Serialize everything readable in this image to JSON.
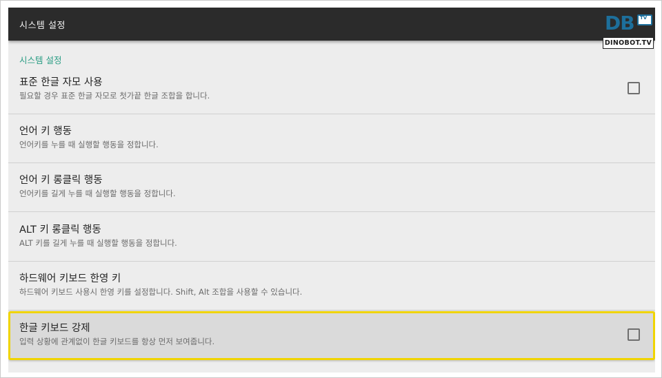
{
  "actionbar": {
    "title": "시스템 설정"
  },
  "category": {
    "label": "시스템 설정"
  },
  "preferences": [
    {
      "title": "표준 한글 자모 사용",
      "summary": "필요할 경우 표준 한글 자모로 첫가끝 한글 조합을 합니다.",
      "checked": false
    },
    {
      "title": "언어 키 행동",
      "summary": "언어키를 누를 때 실행할 행동을 정합니다."
    },
    {
      "title": "언어 키 롱클릭 행동",
      "summary": "언어키를 길게 누를 때 실행할 행동을 정합니다."
    },
    {
      "title": "ALT 키 롱클릭 행동",
      "summary": "ALT 키를 길게 누를 때 실행할 행동을 정합니다."
    },
    {
      "title": "하드웨어 키보드 한영 키",
      "summary": "하드웨어 키보드 사용시 한영 키를 설정합니다. Shift, Alt 조합을 사용할 수 있습니다."
    },
    {
      "title": "한글 키보드 강제",
      "summary": "입력 상황에 관계없이 한글 키보드를 항상 먼저 보여줍니다.",
      "checked": false,
      "focused": true
    }
  ],
  "watermark": {
    "letters": "DB",
    "tv": "TV",
    "wordmark": "DINOBOT.TV"
  },
  "colors": {
    "actionbar": "#2b2b2b",
    "accent": "#2a9d84",
    "focus": "#f0d400",
    "logo": "#1d6f9b"
  }
}
